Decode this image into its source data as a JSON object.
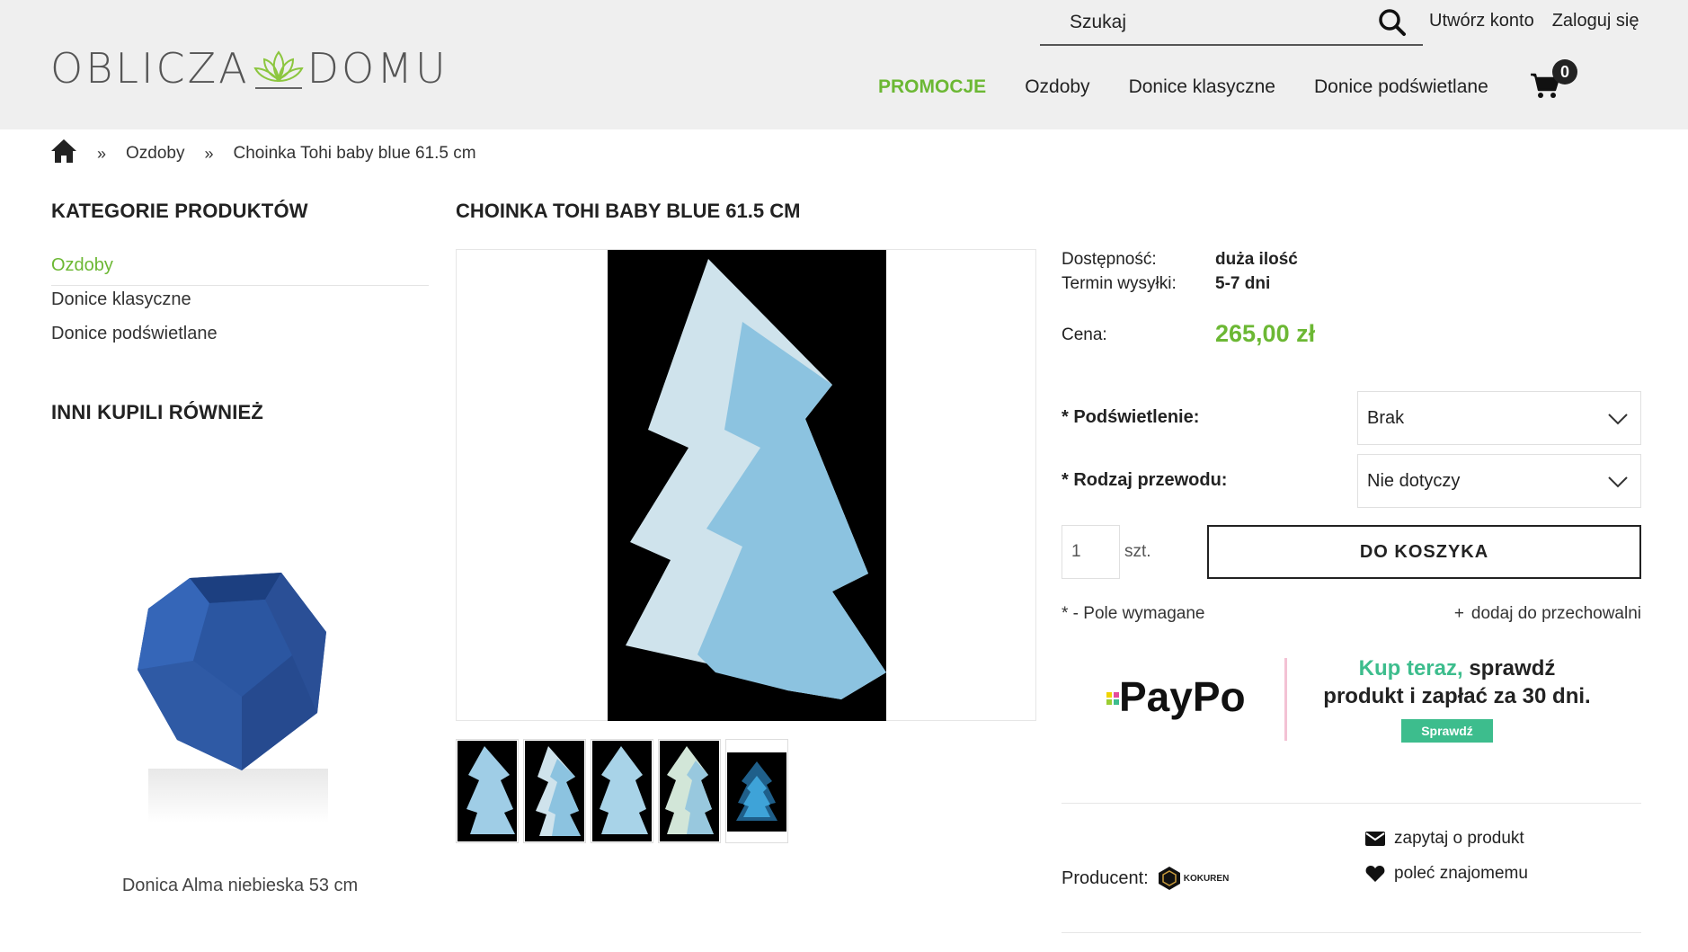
{
  "header": {
    "logo_left": "OBLICZA",
    "logo_right": "DOMU",
    "search_placeholder": "Szukaj",
    "account_links": [
      "Utwórz konto",
      "Zaloguj się"
    ],
    "nav": [
      "PROMOCJE",
      "Ozdoby",
      "Donice klasyczne",
      "Donice podświetlane"
    ],
    "cart_count": "0"
  },
  "breadcrumb": {
    "sep": "»",
    "items": [
      "Ozdoby",
      "Choinka Tohi baby blue 61.5 cm"
    ]
  },
  "sidebar": {
    "categories_title": "KATEGORIE PRODUKTÓW",
    "categories": [
      "Ozdoby",
      "Donice klasyczne",
      "Donice podświetlane"
    ],
    "also_bought_title": "INNI KUPILI RÓWNIEŻ",
    "also_bought_product": "Donica Alma niebieska 53 cm"
  },
  "product": {
    "title": "CHOINKA TOHI BABY BLUE 61.5 CM",
    "availability_label": "Dostępność:",
    "availability_value": "duża ilość",
    "shipping_label": "Termin wysyłki:",
    "shipping_value": "5-7 dni",
    "price_label": "Cena:",
    "price_value": "265,00 zł",
    "option1_label": "* Podświetlenie:",
    "option1_value": "Brak",
    "option2_label": "* Rodzaj przewodu:",
    "option2_value": "Nie dotyczy",
    "qty_value": "1",
    "qty_unit": "szt.",
    "add_to_cart": "DO KOSZYKA",
    "required_note": "* - Pole wymagane",
    "wishlist_plus": "+",
    "wishlist": "dodaj do przechowalni",
    "ask": "zapytaj o produkt",
    "recommend": "poleć znajomemu",
    "producer_label": "Producent:",
    "producer_name": "KOKUREN"
  },
  "paypo": {
    "logo": "PayPo",
    "line1_highlight": "Kup teraz,",
    "line1_rest": " sprawdź",
    "line2": "produkt i zapłać za 30 dni.",
    "button": "Sprawdź"
  },
  "colors": {
    "accent_green": "#6cb834",
    "paypo_green": "#3dbd8d",
    "header_bg": "#efefef"
  }
}
